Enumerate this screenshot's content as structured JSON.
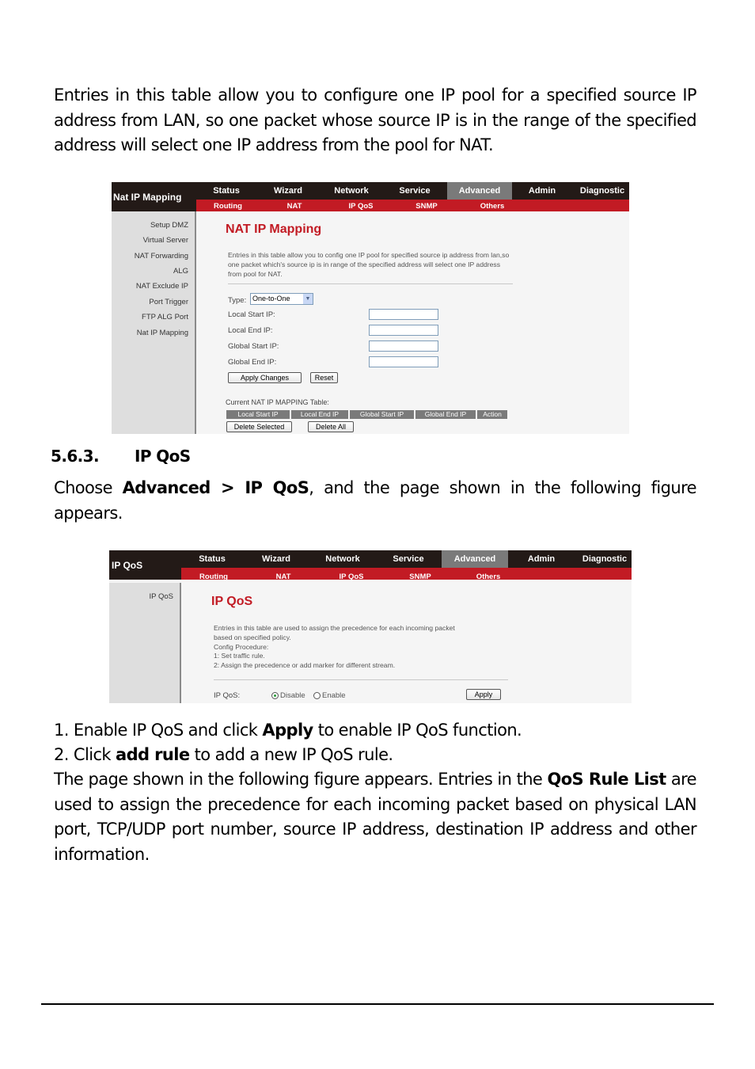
{
  "document": {
    "intro_paragraph": "Entries in this table allow you to configure one IP pool for a specified source IP address from LAN, so one packet whose source IP is in the range of the specified address will select one IP address from the pool for NAT.",
    "section": {
      "number": "5.6.3.",
      "title": "IP QoS"
    },
    "choose_paragraph": {
      "pre": "Choose ",
      "bold": "Advanced > IP QoS",
      "post": ", and the page shown in the following figure appears."
    },
    "step1": {
      "pre": "1. Enable IP QoS and click ",
      "bold": "Apply",
      "post": " to enable IP QoS function."
    },
    "step2": {
      "pre": "2. Click ",
      "bold": "add rule",
      "post": " to add a new IP QoS rule."
    },
    "rule_paragraph": {
      "pre": "The page shown in the following figure appears. Entries in the ",
      "bold": "QoS Rule List",
      "post": " are used to assign the precedence for each incoming packet based on physical LAN port, TCP/UDP port number, source IP address, destination IP address and other information."
    }
  },
  "nat_screenshot": {
    "brand": "Nat IP Mapping",
    "nav": [
      "Status",
      "Wizard",
      "Network",
      "Service",
      "Advanced",
      "Admin",
      "Diagnostic"
    ],
    "active_nav": "Advanced",
    "subnav": [
      "Routing",
      "NAT",
      "IP QoS",
      "SNMP",
      "Others"
    ],
    "sidebar": [
      "Setup DMZ",
      "Virtual Server",
      "NAT Forwarding",
      "ALG",
      "NAT Exclude IP",
      "Port Trigger",
      "FTP ALG Port",
      "Nat IP Mapping"
    ],
    "title": "NAT IP Mapping",
    "description": "Entries in this table allow you to config one IP pool for specified source ip address from lan,so one packet which's source ip is in range of the specified address will select one IP address from pool for NAT.",
    "type_label": "Type:",
    "type_value": "One-to-One",
    "fields": [
      {
        "label": "Local Start IP:",
        "value": ""
      },
      {
        "label": "Local End IP:",
        "value": ""
      },
      {
        "label": "Global Start IP:",
        "value": ""
      },
      {
        "label": "Global End IP:",
        "value": ""
      }
    ],
    "apply_label": "Apply Changes",
    "reset_label": "Reset",
    "table_caption": "Current NAT IP MAPPING Table:",
    "table_headers": [
      "Local Start IP",
      "Local End IP",
      "Global Start IP",
      "Global End IP",
      "Action"
    ],
    "delete_selected_label": "Delete Selected",
    "delete_all_label": "Delete All"
  },
  "qos_screenshot": {
    "brand": "IP QoS",
    "nav": [
      "Status",
      "Wizard",
      "Network",
      "Service",
      "Advanced",
      "Admin",
      "Diagnostic"
    ],
    "active_nav": "Advanced",
    "subnav": [
      "Routing",
      "NAT",
      "IP QoS",
      "SNMP",
      "Others"
    ],
    "sidebar": [
      "IP QoS"
    ],
    "title": "IP QoS",
    "description_lines": [
      "Entries in this table are used to assign the precedence for each incoming packet",
      "based on specified policy.",
      "Config Procedure:",
      "1: Set traffic rule.",
      "2: Assign the precedence or add marker for different stream."
    ],
    "qos_label": "IP QoS:",
    "options": [
      {
        "label": "Disable",
        "selected": true
      },
      {
        "label": "Enable",
        "selected": false
      }
    ],
    "apply_label": "Apply"
  }
}
